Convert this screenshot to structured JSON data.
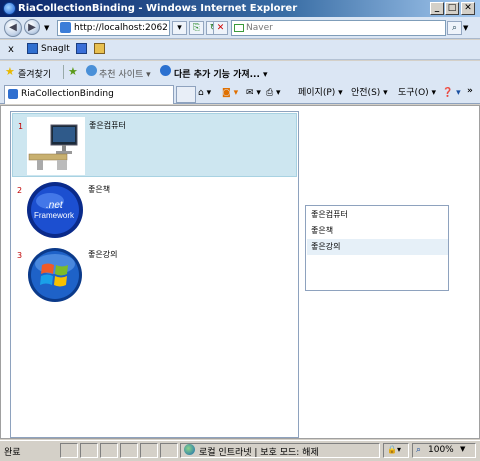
{
  "window": {
    "title": "RiaCollectionBinding - Windows Internet Explorer"
  },
  "address": {
    "url": "http://localhost:2062",
    "search_placeholder": "Naver"
  },
  "toolbar": {
    "close_x": "x",
    "snagit_label": "SnagIt"
  },
  "favorites": {
    "favorites_label": "즐겨찾기",
    "suggested_label": "추천 사이트",
    "more_addons_label": "다른 추가 기능 가져..."
  },
  "tab": {
    "title": "RiaCollectionBinding"
  },
  "commands": {
    "page_label": "페이지(P)",
    "safety_label": "안전(S)",
    "tools_label": "도구(O)",
    "more": "»"
  },
  "left_list": {
    "items": [
      {
        "number": "1",
        "label": "좋은컴퓨터",
        "icon": "computer-image"
      },
      {
        "number": "2",
        "label": "좋은책",
        "icon": "dotnet-framework-image",
        "img_text_1": ".net",
        "img_text_2": "Framework"
      },
      {
        "number": "3",
        "label": "좋은강의",
        "icon": "windows-logo-image"
      }
    ],
    "selected_index": 0
  },
  "right_list": {
    "items": [
      "좋은컴퓨터",
      "좋은책",
      "좋은강의"
    ],
    "highlighted_index": 2
  },
  "status": {
    "left_text": "완료",
    "zone_text": "로컬 인트라넷 | 보호 모드: 해제",
    "zoom_text": "100%"
  },
  "colors": {
    "selection": "#cde6f0",
    "number_red": "#c00000",
    "title_blue": "#0a246a"
  }
}
